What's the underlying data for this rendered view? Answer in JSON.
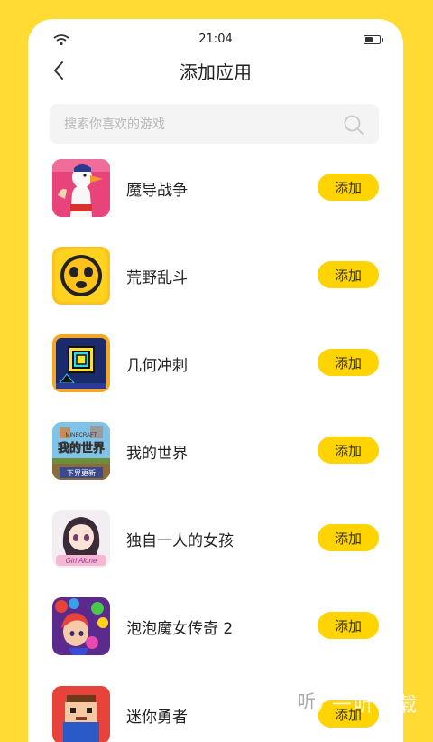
{
  "status_bar": {
    "time": "21:04",
    "battery_level": 0.55
  },
  "header": {
    "title": "添加应用",
    "back_icon": "chevron-left-icon"
  },
  "search": {
    "placeholder": "搜索你喜欢的游戏",
    "icon": "search-icon"
  },
  "apps": [
    {
      "name": "魔导战争",
      "button": "添加",
      "icon": "goose-app-icon"
    },
    {
      "name": "荒野乱斗",
      "button": "添加",
      "icon": "brawl-skull-app-icon"
    },
    {
      "name": "几何冲刺",
      "button": "添加",
      "icon": "geometry-cube-app-icon"
    },
    {
      "name": "我的世界",
      "button": "添加",
      "icon": "minecraft-app-icon",
      "icon_text": {
        "top": "MINECRAFT",
        "main": "我的世界",
        "sub": "下界更新"
      }
    },
    {
      "name": "独自一人的女孩",
      "button": "添加",
      "icon": "anime-girl-app-icon",
      "icon_text": "Girl Alone"
    },
    {
      "name": "泡泡魔女传奇 2",
      "button": "添加",
      "icon": "bubble-witch-app-icon"
    },
    {
      "name": "迷你勇者",
      "button": "添加",
      "icon": "pixel-hero-app-icon"
    }
  ],
  "colors": {
    "accent": "#FFD400",
    "background": "#FFDB33"
  },
  "watermark": {
    "text": "一听下载",
    "glyph": "听"
  }
}
